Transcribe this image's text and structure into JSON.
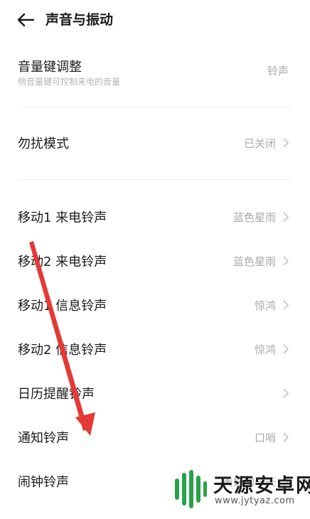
{
  "header": {
    "title": "声音与振动"
  },
  "volume": {
    "label": "音量键调整",
    "sub": "侧音量键可控制来电的音量",
    "value": "铃声"
  },
  "dnd": {
    "label": "勿扰模式",
    "value": "已关闭"
  },
  "items": [
    {
      "label": "移动1 来电铃声",
      "value": "蓝色星雨"
    },
    {
      "label": "移动2 来电铃声",
      "value": "蓝色星雨"
    },
    {
      "label": "移动1 信息铃声",
      "value": "惊鸿"
    },
    {
      "label": "移动2 信息铃声",
      "value": "惊鸿"
    },
    {
      "label": "日历提醒铃声",
      "value": ""
    },
    {
      "label": "通知铃声",
      "value": "口哨"
    },
    {
      "label": "闹钟铃声",
      "value": "美好的一天"
    }
  ],
  "watermark": {
    "name": "天源安卓网",
    "url": "www.jytyaz.com"
  },
  "colors": {
    "arrow": "#e53935",
    "value": "#a9a9a9",
    "watermark_green": "#2aa149"
  }
}
